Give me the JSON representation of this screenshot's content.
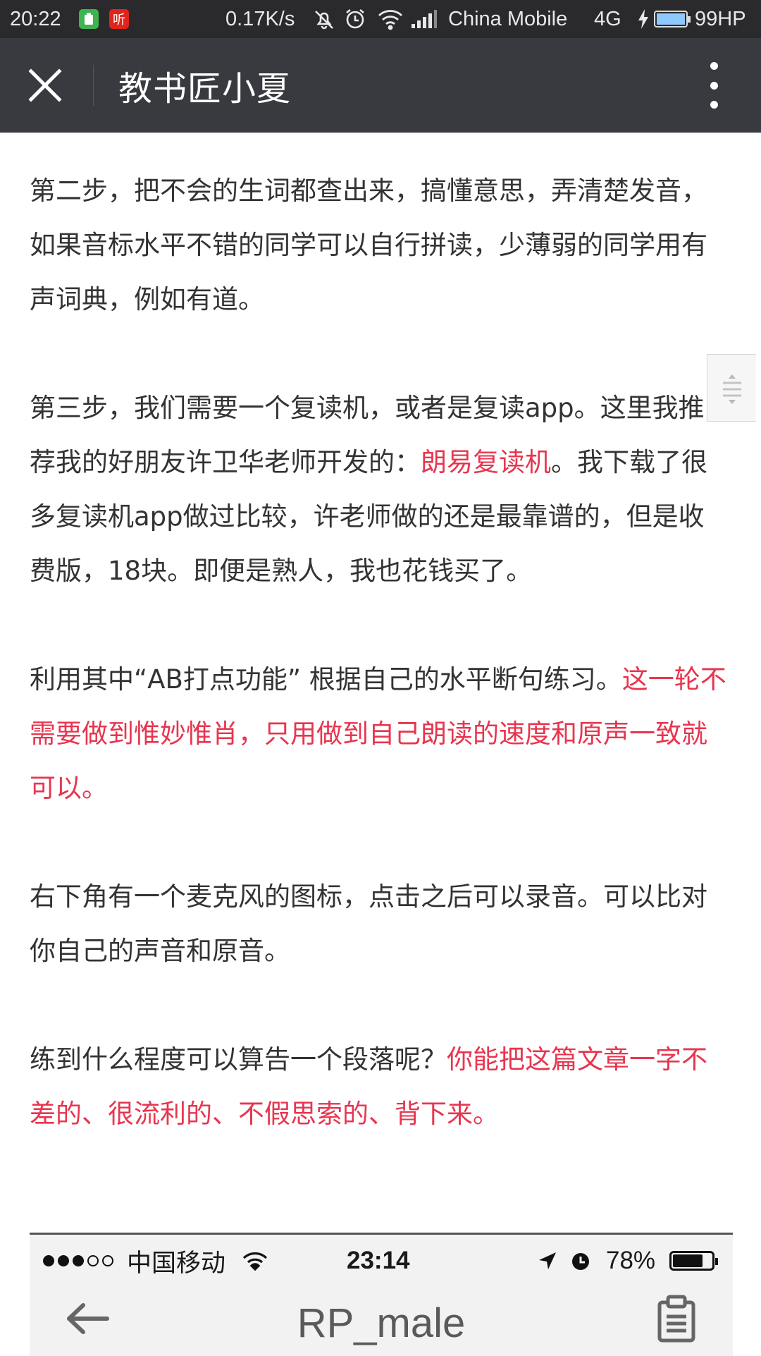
{
  "status_bar": {
    "time": "20:22",
    "listen_badge": "听",
    "net_speed": "0.17K/s",
    "carrier": "China Mobile",
    "network": "4G",
    "battery_label": "99HP",
    "battery_level": 0.99
  },
  "header": {
    "title": "教书匠小夏"
  },
  "article": {
    "p1": "第二步，把不会的生词都查出来，搞懂意思，弄清楚发音，如果音标水平不错的同学可以自行拼读，少薄弱的同学用有声词典，例如有道。",
    "p2_a": "第三步，我们需要一个复读机，或者是复读app。这里我推荐我的好朋友许卫华老师开发的：",
    "p2_link": "朗易复读机",
    "p2_b": "。我下载了很多复读机app做过比较，许老师做的还是最靠谱的，但是收费版，18块。即便是熟人，我也花钱买了。",
    "p3_a": "利用其中“AB打点功能” 根据自己的水平断句练习。",
    "p3_red": "这一轮不需要做到惟妙惟肖，只用做到自己朗读的速度和原声一致就可以。",
    "p4": "右下角有一个麦克风的图标，点击之后可以录音。可以比对你自己的声音和原音。",
    "p5_a": "练到什么程度可以算告一个段落呢？",
    "p5_red": "你能把这篇文章一字不差的、很流利的、不假思索的、背下来。"
  },
  "embedded_screenshot": {
    "carrier": "中国移动",
    "time": "23:14",
    "battery": "78%",
    "battery_level": 0.78,
    "title": "RP_male"
  },
  "colors": {
    "accent_red": "#e8354f",
    "header_bg": "#393a3f",
    "status_bg": "#2a2a2c"
  }
}
